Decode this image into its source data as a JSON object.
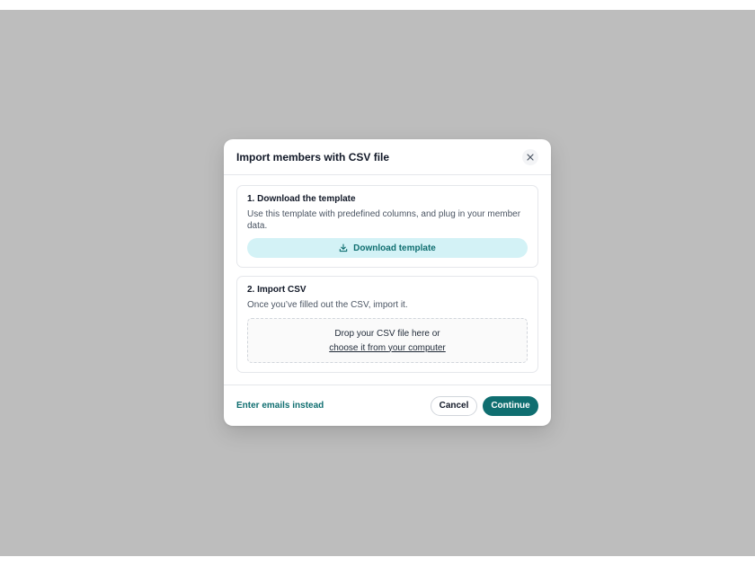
{
  "modal": {
    "title": "Import members with CSV file",
    "close_icon": "close-icon"
  },
  "download_section": {
    "title": "1. Download the template",
    "description": "Use this template with predefined columns, and plug in your member data.",
    "button_label": "Download template",
    "button_icon": "download-icon"
  },
  "import_section": {
    "title": "2. Import CSV",
    "description": "Once you’ve filled out the CSV, import it.",
    "dropzone_text": "Drop your CSV file here or",
    "dropzone_link": "choose it from your computer"
  },
  "footer": {
    "alt_link": "Enter emails instead",
    "cancel_label": "Cancel",
    "continue_label": "Continue"
  },
  "colors": {
    "backdrop": "#bdbdbd",
    "accent": "#0f6e70",
    "accent_light": "#d3f2f6"
  }
}
